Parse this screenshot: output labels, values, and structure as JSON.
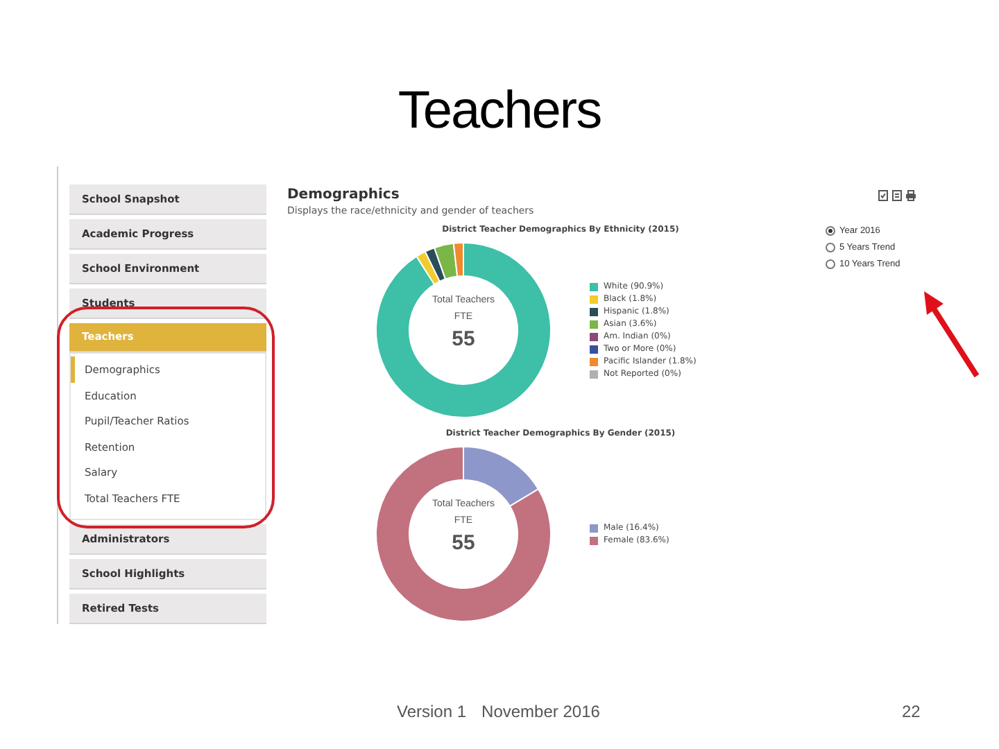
{
  "slide_title": "Teachers",
  "sidebar": {
    "items": [
      {
        "label": "School Snapshot",
        "selected": false
      },
      {
        "label": "Academic Progress",
        "selected": false
      },
      {
        "label": "School Environment",
        "selected": false
      },
      {
        "label": "Students",
        "selected": false
      },
      {
        "label": "Teachers",
        "selected": true,
        "expanded": true,
        "children": [
          {
            "label": "Demographics",
            "selected": true
          },
          {
            "label": "Education",
            "selected": false
          },
          {
            "label": "Pupil/Teacher Ratios",
            "selected": false
          },
          {
            "label": "Retention",
            "selected": false
          },
          {
            "label": "Salary",
            "selected": false
          },
          {
            "label": "Total Teachers FTE",
            "selected": false
          }
        ]
      },
      {
        "label": "Administrators",
        "selected": false
      },
      {
        "label": "School Highlights",
        "selected": false
      },
      {
        "label": "Retired Tests",
        "selected": false
      }
    ]
  },
  "content": {
    "heading": "Demographics",
    "subtitle": "Displays the race/ethnicity and gender of teachers",
    "charts": [
      {
        "center_label": "Total Teachers FTE",
        "center_value": "55",
        "chart_data": {
          "type": "donut",
          "title": "District Teacher Demographics By Ethnicity (2015)",
          "legend": "right",
          "categories": [
            "White (90.9%)",
            "Black (1.8%)",
            "Hispanic (1.8%)",
            "Asian (3.6%)",
            "Am. Indian (0%)",
            "Two or More (0%)",
            "Pacific Islander (1.8%)",
            "Not Reported (0%)"
          ],
          "colors": [
            "#3dbfa8",
            "#f2cb2c",
            "#2b4d5a",
            "#7ab648",
            "#8b4a7a",
            "#3a4fa0",
            "#f08a2c",
            "#b0b0b0"
          ],
          "values": [
            90.9,
            1.8,
            1.8,
            3.6,
            0,
            0,
            1.8,
            0
          ]
        }
      },
      {
        "center_label": "Total Teachers FTE",
        "center_value": "55",
        "chart_data": {
          "type": "donut",
          "title": "District Teacher Demographics By Gender (2015)",
          "legend": "right",
          "categories": [
            "Male (16.4%)",
            "Female (83.6%)"
          ],
          "colors": [
            "#8e97c9",
            "#c2717f"
          ],
          "values": [
            16.4,
            83.6
          ]
        }
      }
    ]
  },
  "view_options": [
    {
      "label": "Year 2016",
      "selected": true
    },
    {
      "label": "5 Years Trend",
      "selected": false
    },
    {
      "label": "10 Years Trend",
      "selected": false
    }
  ],
  "footer": {
    "version": "Version 1",
    "date": "November 2016",
    "page_number": "22"
  }
}
